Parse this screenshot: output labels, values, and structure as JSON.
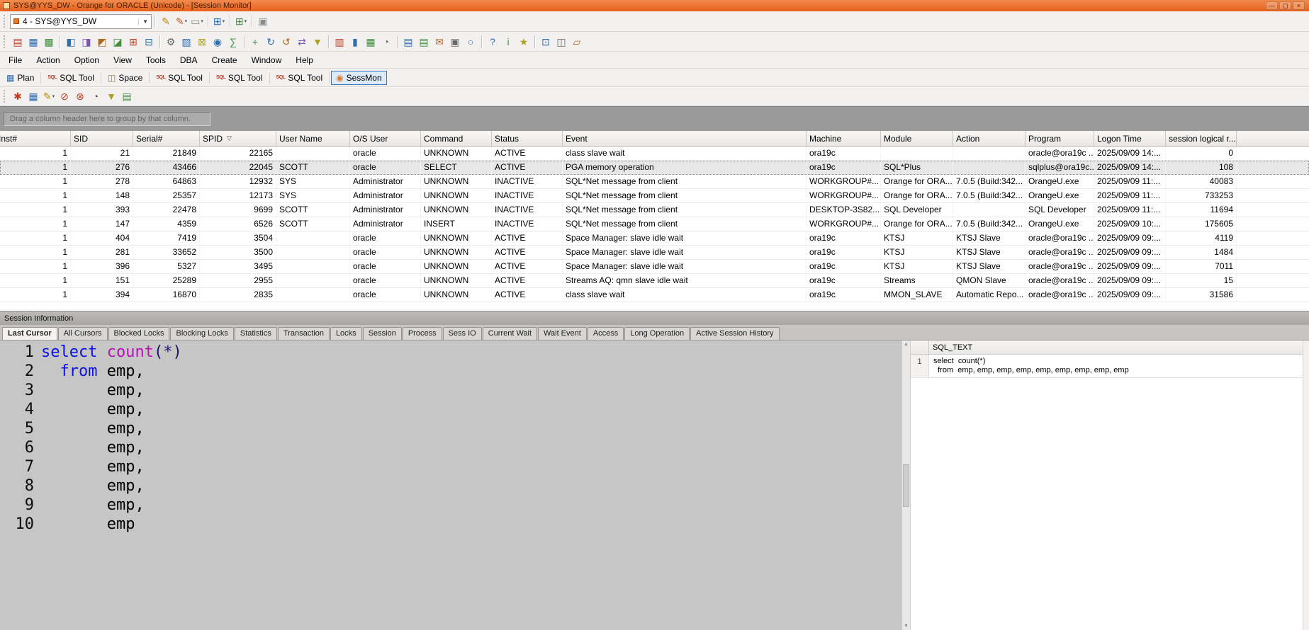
{
  "glyphs": {
    "caret": "▾",
    "combo_caret": "▼",
    "scroll_up": "▲",
    "scroll_down": "▼"
  },
  "window": {
    "title": "SYS@YYS_DW - Orange for ORACLE (Unicode) - [Session Monitor]",
    "buttons": [
      {
        "name": "minimize-button",
        "glyph": "—"
      },
      {
        "name": "maximize-button",
        "glyph": "▢"
      },
      {
        "name": "close-button",
        "glyph": "×"
      }
    ]
  },
  "connection": {
    "value": "4 - SYS@YYS_DW"
  },
  "toolbar1_icons": [
    {
      "name": "edit-pencil-icon",
      "glyph": "✎",
      "color": "#b98a00"
    },
    {
      "name": "edit-pencil-alt-icon",
      "glyph": "✎",
      "color": "#c75b28",
      "caret": true
    },
    {
      "name": "eraser-icon",
      "glyph": "▭",
      "color": "#8a8a8a",
      "caret": true
    },
    {
      "sep": true
    },
    {
      "name": "layout-grid-icon",
      "glyph": "⊞",
      "color": "#2f6db1",
      "caret": true
    },
    {
      "sep": true
    },
    {
      "name": "layout-grid-alt-icon",
      "glyph": "⊞",
      "color": "#3f8f3f",
      "caret": true
    },
    {
      "sep": true
    },
    {
      "name": "pin-layout-icon",
      "glyph": "▣",
      "color": "#8a8a8a"
    }
  ],
  "toolbar2_icons": [
    {
      "name": "new-sql-icon",
      "glyph": "▤",
      "color": "#c23b22"
    },
    {
      "name": "schema-browser-icon",
      "glyph": "▦",
      "color": "#2f6db1"
    },
    {
      "name": "plan-grid-icon",
      "glyph": "▩",
      "color": "#3f8f3f"
    },
    {
      "sep": true
    },
    {
      "name": "table-info-icon",
      "glyph": "◧",
      "color": "#2f6db1"
    },
    {
      "name": "view-info-icon",
      "glyph": "◨",
      "color": "#7a5ab0"
    },
    {
      "name": "procedure-icon",
      "glyph": "◩",
      "color": "#b06a20"
    },
    {
      "name": "function-icon",
      "glyph": "◪",
      "color": "#3f8f3f"
    },
    {
      "name": "trigger-icon",
      "glyph": "⊞",
      "color": "#c23b22"
    },
    {
      "name": "sequence-icon",
      "glyph": "⊟",
      "color": "#2f6db1"
    },
    {
      "sep": true
    },
    {
      "name": "settings-gear-icon",
      "glyph": "⚙",
      "color": "#666666"
    },
    {
      "name": "monitor-chart-icon",
      "glyph": "▧",
      "color": "#2f6db1"
    },
    {
      "name": "lock-monitor-icon",
      "glyph": "⊠",
      "color": "#b0a020"
    },
    {
      "name": "session-monitor-icon",
      "glyph": "◉",
      "color": "#2f6db1"
    },
    {
      "name": "stats-sigma-icon",
      "glyph": "∑",
      "color": "#3f8f3f"
    },
    {
      "sep": true
    },
    {
      "name": "add-icon",
      "glyph": "+",
      "color": "#3f8f3f"
    },
    {
      "name": "refresh-icon",
      "glyph": "↻",
      "color": "#2f6db1"
    },
    {
      "name": "undo-icon",
      "glyph": "↺",
      "color": "#b06a20"
    },
    {
      "name": "swap-icon",
      "glyph": "⇄",
      "color": "#7a5ab0"
    },
    {
      "name": "filter-icon",
      "glyph": "▼",
      "color": "#b0a020"
    },
    {
      "sep": true
    },
    {
      "name": "report-icon",
      "glyph": "▥",
      "color": "#c23b22"
    },
    {
      "name": "chart-bar-icon",
      "glyph": "▮",
      "color": "#2f6db1"
    },
    {
      "name": "calendar-icon",
      "glyph": "▦",
      "color": "#3f8f3f"
    },
    {
      "name": "clock-icon",
      "glyph": "◔",
      "color": "#666666"
    },
    {
      "sep": true
    },
    {
      "name": "doc-export-icon",
      "glyph": "▤",
      "color": "#2f6db1"
    },
    {
      "name": "doc-import-icon",
      "glyph": "▤",
      "color": "#3f8f3f"
    },
    {
      "name": "mail-icon",
      "glyph": "✉",
      "color": "#b06a20"
    },
    {
      "name": "print-icon",
      "glyph": "▣",
      "color": "#666666"
    },
    {
      "name": "search-icon",
      "glyph": "○",
      "color": "#2f6db1"
    },
    {
      "sep": true
    },
    {
      "name": "help-icon",
      "glyph": "?",
      "color": "#2f6db1"
    },
    {
      "name": "info-icon",
      "glyph": "i",
      "color": "#3f8f3f"
    },
    {
      "name": "favorite-star-icon",
      "glyph": "★",
      "color": "#b0a020"
    },
    {
      "sep": true
    },
    {
      "name": "window-grid-icon",
      "glyph": "⊡",
      "color": "#2f6db1"
    },
    {
      "name": "window-split-icon",
      "glyph": "◫",
      "color": "#666666"
    },
    {
      "name": "window-cascade-icon",
      "glyph": "▱",
      "color": "#b06a20"
    }
  ],
  "menu": {
    "items": [
      "File",
      "Action",
      "Option",
      "View",
      "Tools",
      "DBA",
      "Create",
      "Window",
      "Help"
    ]
  },
  "module_bar": {
    "items": [
      {
        "label": "Plan",
        "icon_name": "plan-icon",
        "icon_glyph": "▦",
        "icon_color": "#2f6db1",
        "text_icon": false,
        "active": false
      },
      {
        "label": "SQL Tool",
        "icon_name": "sql-tool-icon",
        "icon_glyph": "SQL",
        "icon_color": "#c23b22",
        "text_icon": true,
        "active": false
      },
      {
        "label": "Space",
        "icon_name": "space-icon",
        "icon_glyph": "◫",
        "icon_color": "#9b7b2f",
        "text_icon": false,
        "active": false
      },
      {
        "label": "SQL Tool",
        "icon_name": "sql-tool-icon",
        "icon_glyph": "SQL",
        "icon_color": "#c23b22",
        "text_icon": true,
        "active": false
      },
      {
        "label": "SQL Tool",
        "icon_name": "sql-tool-icon",
        "icon_glyph": "SQL",
        "icon_color": "#c23b22",
        "text_icon": true,
        "active": false
      },
      {
        "label": "SQL Tool",
        "icon_name": "sql-tool-icon",
        "icon_glyph": "SQL",
        "icon_color": "#c23b22",
        "text_icon": true,
        "active": false
      },
      {
        "label": "SessMon",
        "icon_name": "sessmon-icon",
        "icon_glyph": "◉",
        "icon_color": "#e87a1e",
        "text_icon": false,
        "active": true
      }
    ]
  },
  "toolbar3_icons": [
    {
      "name": "refresh-flower-icon",
      "glyph": "✱",
      "color": "#c23b22"
    },
    {
      "name": "copy-grid-icon",
      "glyph": "▦",
      "color": "#2f6db1"
    },
    {
      "name": "column-pencil-icon",
      "glyph": "✎",
      "color": "#b98a00",
      "caret": true
    },
    {
      "name": "kill-session-icon",
      "glyph": "⊘",
      "color": "#c23b22"
    },
    {
      "name": "stop-refresh-icon",
      "glyph": "⊗",
      "color": "#c23b22"
    },
    {
      "name": "interval-clock-icon",
      "glyph": "◔",
      "color": "#555555"
    },
    {
      "name": "filter-funnel-icon",
      "glyph": "▼",
      "color": "#b0a020"
    },
    {
      "name": "report-doc-icon",
      "glyph": "▤",
      "color": "#3f8f3f"
    }
  ],
  "group_by_hint": "Drag a column header here to group by that column.",
  "grid": {
    "sort": {
      "column": "SPID",
      "glyph": "▽"
    },
    "columns": [
      {
        "label": "Inst#",
        "align": "right"
      },
      {
        "label": "SID",
        "align": "right"
      },
      {
        "label": "Serial#",
        "align": "right"
      },
      {
        "label": "SPID",
        "align": "right"
      },
      {
        "label": "User Name",
        "align": "left"
      },
      {
        "label": "O/S User",
        "align": "left"
      },
      {
        "label": "Command",
        "align": "left"
      },
      {
        "label": "Status",
        "align": "left"
      },
      {
        "label": "Event",
        "align": "left"
      },
      {
        "label": "Machine",
        "align": "left"
      },
      {
        "label": "Module",
        "align": "left"
      },
      {
        "label": "Action",
        "align": "left"
      },
      {
        "label": "Program",
        "align": "left"
      },
      {
        "label": "Logon Time",
        "align": "left"
      },
      {
        "label": "session logical r...",
        "align": "right"
      }
    ],
    "selected_row": 1,
    "rows": [
      [
        "1",
        "21",
        "21849",
        "22165",
        "",
        "oracle",
        "UNKNOWN",
        "ACTIVE",
        "class slave wait",
        "ora19c",
        "",
        "",
        "oracle@ora19c ...",
        "2025/09/09 14:...",
        "0"
      ],
      [
        "1",
        "276",
        "43466",
        "22045",
        "SCOTT",
        "oracle",
        "SELECT",
        "ACTIVE",
        "PGA memory operation",
        "ora19c",
        "SQL*Plus",
        "",
        "sqlplus@ora19c...",
        "2025/09/09 14:...",
        "108"
      ],
      [
        "1",
        "278",
        "64863",
        "12932",
        "SYS",
        "Administrator",
        "UNKNOWN",
        "INACTIVE",
        "SQL*Net message from client",
        "WORKGROUP#...",
        "Orange for ORA...",
        "7.0.5 (Build:342...",
        "OrangeU.exe",
        "2025/09/09 11:...",
        "40083"
      ],
      [
        "1",
        "148",
        "25357",
        "12173",
        "SYS",
        "Administrator",
        "UNKNOWN",
        "INACTIVE",
        "SQL*Net message from client",
        "WORKGROUP#...",
        "Orange for ORA...",
        "7.0.5 (Build:342...",
        "OrangeU.exe",
        "2025/09/09 11:...",
        "733253"
      ],
      [
        "1",
        "393",
        "22478",
        "9699",
        "SCOTT",
        "Administrator",
        "UNKNOWN",
        "INACTIVE",
        "SQL*Net message from client",
        "DESKTOP-3S82...",
        "SQL Developer",
        "",
        "SQL Developer",
        "2025/09/09 11:...",
        "11694"
      ],
      [
        "1",
        "147",
        "4359",
        "6526",
        "SCOTT",
        "Administrator",
        "INSERT",
        "INACTIVE",
        "SQL*Net message from client",
        "WORKGROUP#...",
        "Orange for ORA...",
        "7.0.5 (Build:342...",
        "OrangeU.exe",
        "2025/09/09 10:...",
        "175605"
      ],
      [
        "1",
        "404",
        "7419",
        "3504",
        "",
        "oracle",
        "UNKNOWN",
        "ACTIVE",
        "Space Manager: slave idle wait",
        "ora19c",
        "KTSJ",
        "KTSJ Slave",
        "oracle@ora19c ...",
        "2025/09/09 09:...",
        "4119"
      ],
      [
        "1",
        "281",
        "33652",
        "3500",
        "",
        "oracle",
        "UNKNOWN",
        "ACTIVE",
        "Space Manager: slave idle wait",
        "ora19c",
        "KTSJ",
        "KTSJ Slave",
        "oracle@ora19c ...",
        "2025/09/09 09:...",
        "1484"
      ],
      [
        "1",
        "396",
        "5327",
        "3495",
        "",
        "oracle",
        "UNKNOWN",
        "ACTIVE",
        "Space Manager: slave idle wait",
        "ora19c",
        "KTSJ",
        "KTSJ Slave",
        "oracle@ora19c ...",
        "2025/09/09 09:...",
        "7011"
      ],
      [
        "1",
        "151",
        "25289",
        "2955",
        "",
        "oracle",
        "UNKNOWN",
        "ACTIVE",
        "Streams AQ: qmn slave idle wait",
        "ora19c",
        "Streams",
        "QMON Slave",
        "oracle@ora19c ...",
        "2025/09/09 09:...",
        "15"
      ],
      [
        "1",
        "394",
        "16870",
        "2835",
        "",
        "oracle",
        "UNKNOWN",
        "ACTIVE",
        "class slave wait",
        "ora19c",
        "MMON_SLAVE",
        "Automatic Repo...",
        "oracle@ora19c ...",
        "2025/09/09 09:...",
        "31586"
      ]
    ]
  },
  "session_info": {
    "title": "Session Information",
    "active_tab": 0,
    "tabs": [
      "Last Cursor",
      "All Cursors",
      "Blocked Locks",
      "Blocking Locks",
      "Statistics",
      "Transaction",
      "Locks",
      "Session",
      "Process",
      "Sess IO",
      "Current Wait",
      "Wait Event",
      "Access",
      "Long Operation",
      "Active Session History"
    ]
  },
  "editor": {
    "lines": [
      {
        "num": "1",
        "tokens": [
          {
            "t": "select",
            "c": "kw"
          },
          {
            "t": " ",
            "c": ""
          },
          {
            "t": "count",
            "c": "fn"
          },
          {
            "t": "(*)",
            "c": "pa"
          }
        ]
      },
      {
        "num": "2",
        "tokens": [
          {
            "t": "  ",
            "c": ""
          },
          {
            "t": "from",
            "c": "kw"
          },
          {
            "t": " emp,",
            "c": ""
          }
        ]
      },
      {
        "num": "3",
        "tokens": [
          {
            "t": "       emp,",
            "c": ""
          }
        ]
      },
      {
        "num": "4",
        "tokens": [
          {
            "t": "       emp,",
            "c": ""
          }
        ]
      },
      {
        "num": "5",
        "tokens": [
          {
            "t": "       emp,",
            "c": ""
          }
        ]
      },
      {
        "num": "6",
        "tokens": [
          {
            "t": "       emp,",
            "c": ""
          }
        ]
      },
      {
        "num": "7",
        "tokens": [
          {
            "t": "       emp,",
            "c": ""
          }
        ]
      },
      {
        "num": "8",
        "tokens": [
          {
            "t": "       emp,",
            "c": ""
          }
        ]
      },
      {
        "num": "9",
        "tokens": [
          {
            "t": "       emp,",
            "c": ""
          }
        ]
      },
      {
        "num": "10",
        "tokens": [
          {
            "t": "       emp",
            "c": ""
          }
        ]
      }
    ]
  },
  "sql_text_panel": {
    "header": "SQL_TEXT",
    "rows": [
      {
        "num": "1",
        "lines": [
          "select  count(*)",
          "  from  emp, emp, emp, emp, emp, emp, emp, emp, emp"
        ]
      }
    ]
  }
}
